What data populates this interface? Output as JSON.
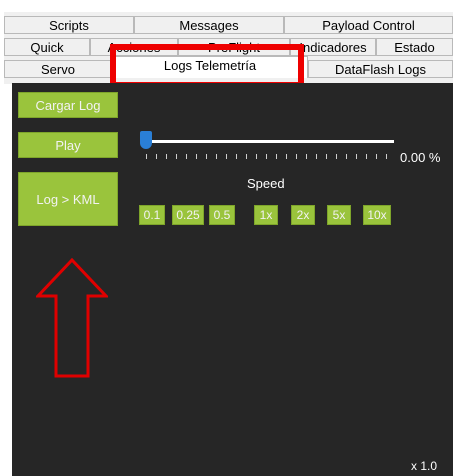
{
  "tabs": {
    "row1": [
      "Scripts",
      "Messages",
      "Payload Control"
    ],
    "row2": [
      "Quick",
      "Acciones",
      "PreFlight",
      "Indicadores",
      "Estado"
    ],
    "row3": [
      "Servo",
      "Logs Telemetría",
      "DataFlash Logs"
    ]
  },
  "buttons": {
    "load_log": "Cargar Log",
    "play": "Play",
    "log_kml": "Log > KML"
  },
  "playback": {
    "percent": "0.00 %",
    "position": 0.0,
    "speed_label": "Speed",
    "speeds": [
      "0.1",
      "0.25",
      "0.5",
      "1x",
      "2x",
      "5x",
      "10x"
    ],
    "multiplier": "x 1.0"
  },
  "colors": {
    "panel_bg": "#262626",
    "button_green": "#9ac43c",
    "highlight_red": "#ee0000",
    "arrow_red": "#e00000"
  },
  "icons": {
    "annotation_arrow": "up-arrow-icon"
  }
}
